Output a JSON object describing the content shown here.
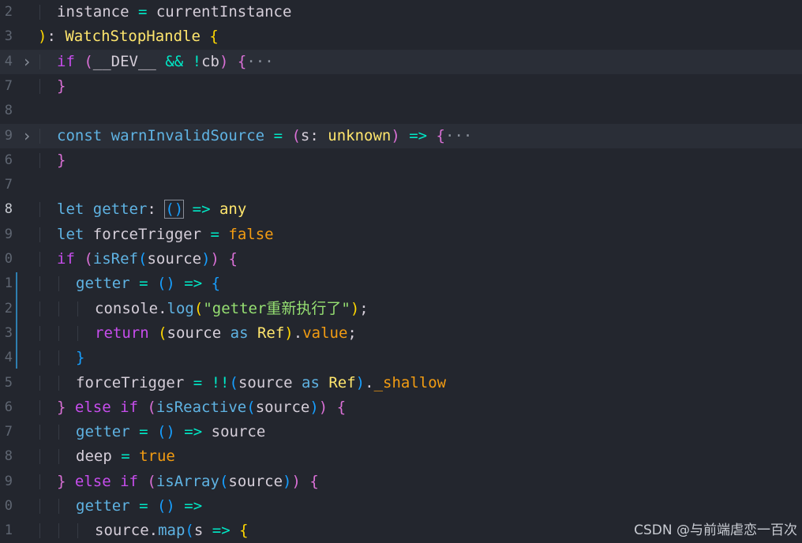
{
  "editor": {
    "lines": [
      {
        "num": "2",
        "fold": "",
        "indent": 1,
        "tokens": [
          [
            "t-var",
            "instance"
          ],
          [
            "t-op",
            " = "
          ],
          [
            "t-var",
            "currentInstance"
          ]
        ]
      },
      {
        "num": "3",
        "fold": "",
        "indent": 0,
        "tokens": [
          [
            "t-brace1",
            ")"
          ],
          [
            "t-punc",
            ": "
          ],
          [
            "t-type",
            "WatchStopHandle"
          ],
          [
            "t-punc",
            " "
          ],
          [
            "t-brace1",
            "{"
          ]
        ]
      },
      {
        "num": "4",
        "fold": ">",
        "indent": 1,
        "highlighted": true,
        "tokens": [
          [
            "t-ctl",
            "if"
          ],
          [
            "t-punc",
            " "
          ],
          [
            "t-brace2",
            "("
          ],
          [
            "t-var",
            "__DEV__"
          ],
          [
            "t-op",
            " && !"
          ],
          [
            "t-var",
            "cb"
          ],
          [
            "t-brace2",
            ")"
          ],
          [
            "t-punc",
            " "
          ],
          [
            "t-brace2",
            "{"
          ],
          [
            "t-dots",
            "···"
          ]
        ]
      },
      {
        "num": "7",
        "fold": "",
        "indent": 1,
        "tokens": [
          [
            "t-brace2",
            "}"
          ]
        ]
      },
      {
        "num": "8",
        "fold": "",
        "indent": 0,
        "tokens": []
      },
      {
        "num": "9",
        "fold": ">",
        "indent": 1,
        "highlighted": true,
        "tokens": [
          [
            "t-kw",
            "const"
          ],
          [
            "t-punc",
            " "
          ],
          [
            "t-fn",
            "warnInvalidSource"
          ],
          [
            "t-op",
            " = "
          ],
          [
            "t-brace2",
            "("
          ],
          [
            "t-param",
            "s"
          ],
          [
            "t-punc",
            ": "
          ],
          [
            "t-type",
            "unknown"
          ],
          [
            "t-brace2",
            ")"
          ],
          [
            "t-op",
            " => "
          ],
          [
            "t-brace2",
            "{"
          ],
          [
            "t-dots",
            "···"
          ]
        ]
      },
      {
        "num": "6",
        "fold": "",
        "indent": 1,
        "tokens": [
          [
            "t-brace2",
            "}"
          ]
        ]
      },
      {
        "num": "7",
        "fold": "",
        "indent": 0,
        "tokens": []
      },
      {
        "num": "8",
        "fold": "",
        "indent": 1,
        "active": true,
        "tokens": [
          [
            "t-kw",
            "let"
          ],
          [
            "t-punc",
            " "
          ],
          [
            "t-fn",
            "getter"
          ],
          [
            "t-punc",
            ": "
          ],
          [
            "t-box",
            "()"
          ],
          [
            "t-op",
            " => "
          ],
          [
            "t-type",
            "any"
          ]
        ]
      },
      {
        "num": "9",
        "fold": "",
        "indent": 1,
        "tokens": [
          [
            "t-kw",
            "let"
          ],
          [
            "t-punc",
            " "
          ],
          [
            "t-var",
            "forceTrigger"
          ],
          [
            "t-op",
            " = "
          ],
          [
            "t-bool",
            "false"
          ]
        ]
      },
      {
        "num": "0",
        "fold": "",
        "indent": 1,
        "tokens": [
          [
            "t-ctl",
            "if"
          ],
          [
            "t-punc",
            " "
          ],
          [
            "t-brace2",
            "("
          ],
          [
            "t-fn",
            "isRef"
          ],
          [
            "t-brace3",
            "("
          ],
          [
            "t-var",
            "source"
          ],
          [
            "t-brace3",
            ")"
          ],
          [
            "t-brace2",
            ")"
          ],
          [
            "t-punc",
            " "
          ],
          [
            "t-brace2",
            "{"
          ]
        ]
      },
      {
        "num": "1",
        "fold": "",
        "indent": 2,
        "mod": true,
        "tokens": [
          [
            "t-fn",
            "getter"
          ],
          [
            "t-op",
            " = "
          ],
          [
            "t-brace3",
            "()"
          ],
          [
            "t-op",
            " => "
          ],
          [
            "t-brace3",
            "{"
          ]
        ]
      },
      {
        "num": "2",
        "fold": "",
        "indent": 3,
        "mod": true,
        "tokens": [
          [
            "t-var",
            "console"
          ],
          [
            "t-punc",
            "."
          ],
          [
            "t-fn",
            "log"
          ],
          [
            "t-brace1",
            "("
          ],
          [
            "t-str",
            "\"getter重新执行了\""
          ],
          [
            "t-brace1",
            ")"
          ],
          [
            "t-punc",
            ";"
          ]
        ]
      },
      {
        "num": "3",
        "fold": "",
        "indent": 3,
        "mod": true,
        "tokens": [
          [
            "t-ctl",
            "return"
          ],
          [
            "t-punc",
            " "
          ],
          [
            "t-brace1",
            "("
          ],
          [
            "t-var",
            "source"
          ],
          [
            "t-kw",
            " as "
          ],
          [
            "t-type",
            "Ref"
          ],
          [
            "t-brace1",
            ")"
          ],
          [
            "t-punc",
            "."
          ],
          [
            "t-prop",
            "value"
          ],
          [
            "t-punc",
            ";"
          ]
        ]
      },
      {
        "num": "4",
        "fold": "",
        "indent": 2,
        "mod": true,
        "tokens": [
          [
            "t-brace3",
            "}"
          ]
        ]
      },
      {
        "num": "5",
        "fold": "",
        "indent": 2,
        "tokens": [
          [
            "t-var",
            "forceTrigger"
          ],
          [
            "t-op",
            " = !!"
          ],
          [
            "t-brace3",
            "("
          ],
          [
            "t-var",
            "source"
          ],
          [
            "t-kw",
            " as "
          ],
          [
            "t-type",
            "Ref"
          ],
          [
            "t-brace3",
            ")"
          ],
          [
            "t-punc",
            "."
          ],
          [
            "t-prop",
            "_shallow"
          ]
        ]
      },
      {
        "num": "6",
        "fold": "",
        "indent": 1,
        "tokens": [
          [
            "t-brace2",
            "}"
          ],
          [
            "t-ctl",
            " else if "
          ],
          [
            "t-brace2",
            "("
          ],
          [
            "t-fn",
            "isReactive"
          ],
          [
            "t-brace3",
            "("
          ],
          [
            "t-var",
            "source"
          ],
          [
            "t-brace3",
            ")"
          ],
          [
            "t-brace2",
            ")"
          ],
          [
            "t-punc",
            " "
          ],
          [
            "t-brace2",
            "{"
          ]
        ]
      },
      {
        "num": "7",
        "fold": "",
        "indent": 2,
        "tokens": [
          [
            "t-fn",
            "getter"
          ],
          [
            "t-op",
            " = "
          ],
          [
            "t-brace3",
            "()"
          ],
          [
            "t-op",
            " => "
          ],
          [
            "t-var",
            "source"
          ]
        ]
      },
      {
        "num": "8",
        "fold": "",
        "indent": 2,
        "tokens": [
          [
            "t-var",
            "deep"
          ],
          [
            "t-op",
            " = "
          ],
          [
            "t-bool",
            "true"
          ]
        ]
      },
      {
        "num": "9",
        "fold": "",
        "indent": 1,
        "tokens": [
          [
            "t-brace2",
            "}"
          ],
          [
            "t-ctl",
            " else if "
          ],
          [
            "t-brace2",
            "("
          ],
          [
            "t-fn",
            "isArray"
          ],
          [
            "t-brace3",
            "("
          ],
          [
            "t-var",
            "source"
          ],
          [
            "t-brace3",
            ")"
          ],
          [
            "t-brace2",
            ")"
          ],
          [
            "t-punc",
            " "
          ],
          [
            "t-brace2",
            "{"
          ]
        ]
      },
      {
        "num": "0",
        "fold": "",
        "indent": 2,
        "tokens": [
          [
            "t-fn",
            "getter"
          ],
          [
            "t-op",
            " = "
          ],
          [
            "t-brace3",
            "()"
          ],
          [
            "t-op",
            " =>"
          ]
        ]
      },
      {
        "num": "1",
        "fold": "",
        "indent": 3,
        "tokens": [
          [
            "t-var",
            "source"
          ],
          [
            "t-punc",
            "."
          ],
          [
            "t-fn",
            "map"
          ],
          [
            "t-brace3",
            "("
          ],
          [
            "t-param",
            "s"
          ],
          [
            "t-op",
            " => "
          ],
          [
            "t-brace1",
            "{"
          ]
        ]
      }
    ]
  },
  "watermark": "CSDN @与前端虐恋一百次"
}
